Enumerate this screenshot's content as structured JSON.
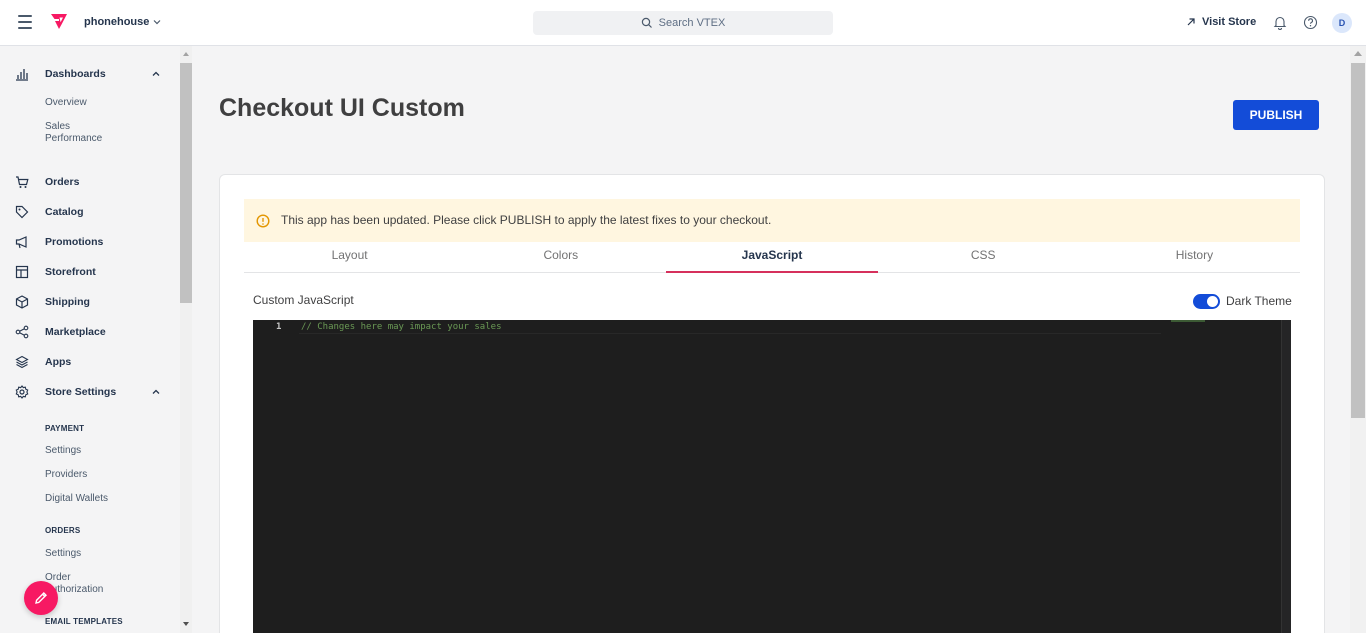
{
  "topbar": {
    "account": "phonehouse",
    "search_placeholder": "Search VTEX",
    "visit_store": "Visit Store",
    "avatar_letter": "D"
  },
  "sidebar": {
    "dashboards": "Dashboards",
    "dashboards_sub": [
      "Overview",
      "Sales Performance"
    ],
    "items": [
      "Orders",
      "Catalog",
      "Promotions",
      "Storefront",
      "Shipping",
      "Marketplace",
      "Apps"
    ],
    "store_settings": "Store Settings",
    "payment_header": "PAYMENT",
    "payment_items": [
      "Settings",
      "Providers",
      "Digital Wallets"
    ],
    "orders_header": "ORDERS",
    "orders_items": [
      "Settings",
      "Order Authorization"
    ],
    "email_header": "EMAIL TEMPLATES"
  },
  "main": {
    "title": "Checkout UI Custom",
    "publish_label": "PUBLISH",
    "alert_text": "This app has been updated. Please click PUBLISH to apply the latest fixes to your checkout.",
    "tabs": [
      {
        "label": "Layout",
        "active": false
      },
      {
        "label": "Colors",
        "active": false
      },
      {
        "label": "JavaScript",
        "active": true
      },
      {
        "label": "CSS",
        "active": false
      },
      {
        "label": "History",
        "active": false
      }
    ],
    "editor_label": "Custom JavaScript",
    "theme_toggle_label": "Dark Theme",
    "code_lines": [
      {
        "num": "1",
        "text": "// Changes here may impact your sales"
      }
    ]
  },
  "colors": {
    "accent_blue": "#134cd8",
    "vtex_pink": "#f71963",
    "tab_underline": "#d6305c",
    "alert_bg": "#fff6e0",
    "editor_bg": "#1e1e1e",
    "comment_green": "#6a9955"
  }
}
